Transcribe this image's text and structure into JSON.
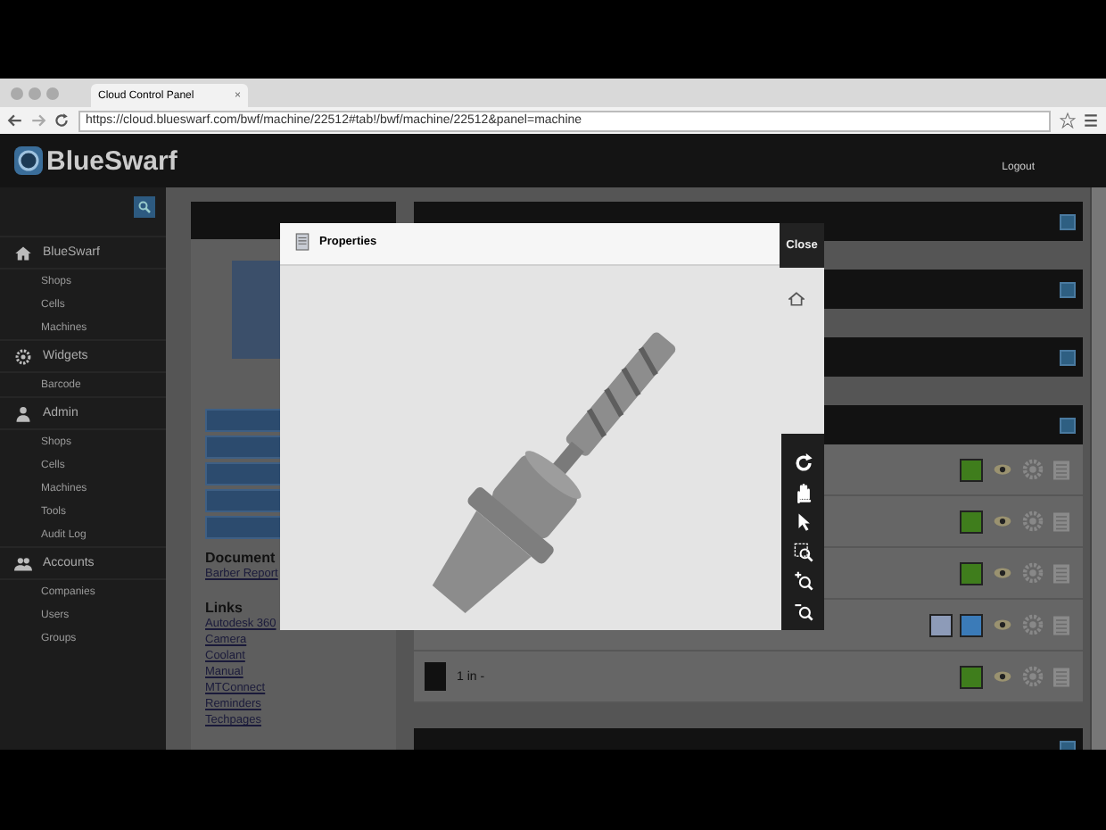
{
  "browser": {
    "tab_title": "Cloud Control Panel",
    "tab_close": "×",
    "url": "https://cloud.blueswarf.com/bwf/machine/22512#tab!/bwf/machine/22512&panel=machine"
  },
  "header": {
    "logo": "BlueSwarf",
    "logout": "Logout"
  },
  "sidebar": {
    "sections": [
      {
        "label": "BlueSwarf",
        "kind": "home",
        "items": [
          "Shops",
          "Cells",
          "Machines"
        ]
      },
      {
        "label": "Widgets",
        "kind": "gear",
        "items": [
          "Barcode"
        ]
      },
      {
        "label": "Admin",
        "kind": "person",
        "items": [
          "Shops",
          "Cells",
          "Machines",
          "Tools",
          "Audit Log"
        ]
      },
      {
        "label": "Accounts",
        "kind": "people",
        "items": [
          "Companies",
          "Users",
          "Groups"
        ]
      }
    ]
  },
  "machine_card": {
    "documents_heading": "Document",
    "documents": [
      "Barber Report"
    ],
    "links_heading": "Links",
    "links": [
      "Autodesk 360",
      "Camera",
      "Coolant",
      "Manual",
      "MTConnect",
      "Reminders",
      "Techpages"
    ]
  },
  "tool_rows": [
    {
      "statuses": [
        {
          "color": "#3f7d1c"
        }
      ]
    },
    {
      "statuses": [
        {
          "color": "#3f7d1c"
        }
      ]
    },
    {
      "statuses": [
        {
          "color": "#3f7d1c"
        }
      ]
    },
    {
      "statuses": [
        {
          "color": "#8d9bb8"
        },
        {
          "color": "#3b7bb8"
        }
      ]
    },
    {
      "title": "1 in -",
      "statuses": [
        {
          "color": "#3f7d1c"
        }
      ]
    }
  ],
  "modal": {
    "title": "Properties",
    "close": "Close"
  }
}
